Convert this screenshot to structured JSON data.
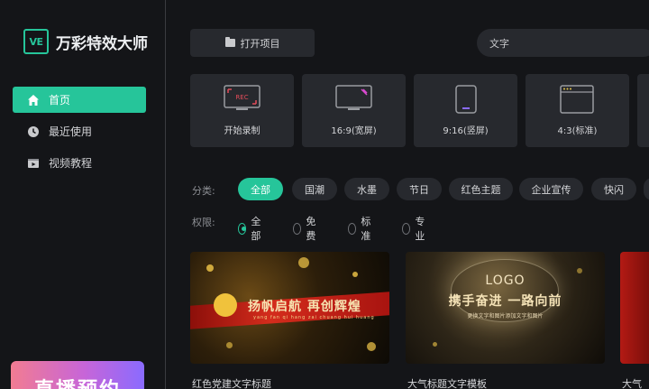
{
  "app": {
    "logo_badge": "VE",
    "name": "万彩特效大师"
  },
  "sidebar": {
    "items": [
      {
        "label": "首页",
        "icon": "home-icon",
        "active": true
      },
      {
        "label": "最近使用",
        "icon": "clock-icon",
        "active": false
      },
      {
        "label": "视频教程",
        "icon": "video-icon",
        "active": false
      }
    ],
    "promo_text": "直播预约"
  },
  "toolbar": {
    "open_label": "打开项目"
  },
  "search": {
    "value": "文字"
  },
  "create_cards": [
    {
      "label": "开始录制",
      "icon": "record-screen-icon"
    },
    {
      "label": "16:9(宽屏)",
      "icon": "widescreen-icon"
    },
    {
      "label": "9:16(竖屏)",
      "icon": "portrait-icon"
    },
    {
      "label": "4:3(标准)",
      "icon": "standard-icon"
    }
  ],
  "filters": {
    "category_label": "分类:",
    "categories": [
      "全部",
      "国潮",
      "水墨",
      "节日",
      "红色主题",
      "企业宣传",
      "快闪"
    ],
    "active_category": "全部",
    "permission_label": "权限:",
    "permissions": [
      "全部",
      "免费",
      "标准",
      "专业"
    ],
    "active_permission": "全部"
  },
  "templates": [
    {
      "title": "红色党建文字标题",
      "headline": "扬帆启航 再创辉煌",
      "subline": "yang fan qi hang zai chuang hui huang"
    },
    {
      "title": "大气标题文字模板",
      "logo": "LOGO",
      "headline": "携手奋进 一路向前",
      "subline": "更换文字和图片添加文字和图片"
    },
    {
      "title": "大气"
    }
  ],
  "colors": {
    "accent": "#26c59a",
    "background": "#141518",
    "panel": "#27292e"
  }
}
